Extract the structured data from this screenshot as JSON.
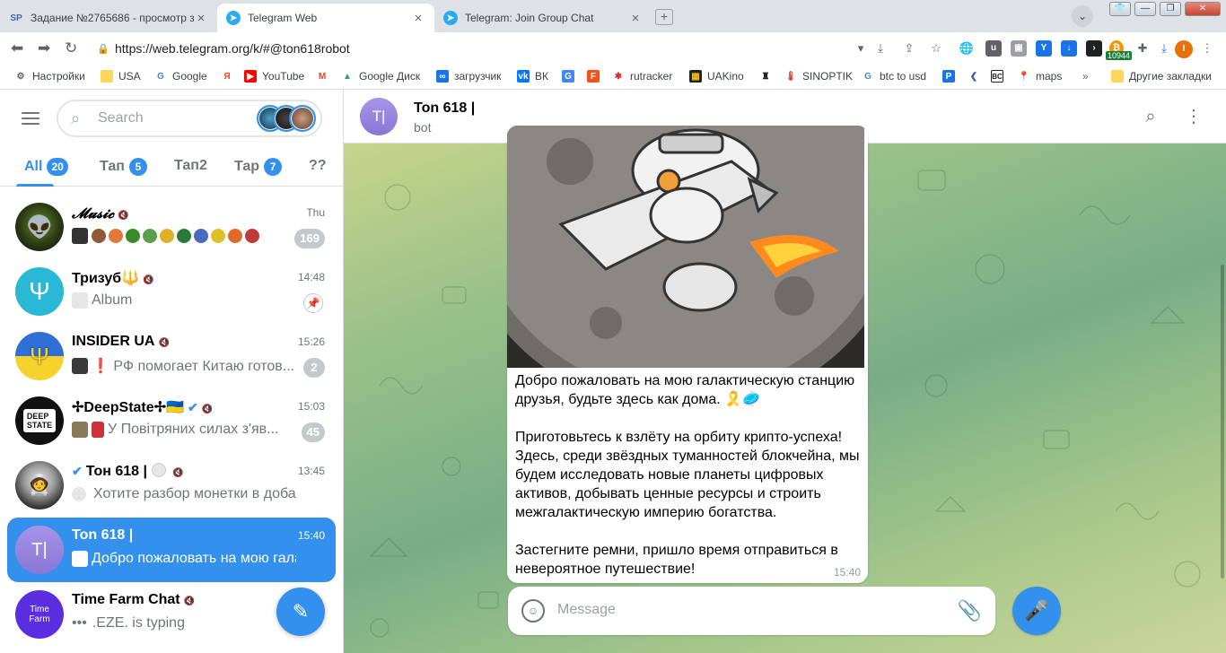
{
  "browser": {
    "tabs": [
      {
        "title": "Задание №2765686 - просмотр з",
        "favicon": "SP"
      },
      {
        "title": "Telegram Web",
        "favicon": "telegram-icon",
        "active": true
      },
      {
        "title": "Telegram: Join Group Chat",
        "favicon": "telegram-icon"
      }
    ],
    "url": "https://web.telegram.org/k/#@ton618robot",
    "extension_badge": "10944",
    "profile_initial": "I",
    "bookmarks": [
      {
        "label": "Настройки",
        "icon": "gear-icon"
      },
      {
        "label": "USA",
        "icon": "folder-icon"
      },
      {
        "label": "Google",
        "icon": "google-icon"
      },
      {
        "label": "",
        "icon": "yandex-icon"
      },
      {
        "label": "YouTube",
        "icon": "youtube-icon"
      },
      {
        "label": "",
        "icon": "gmail-icon"
      },
      {
        "label": "Google Диск",
        "icon": "drive-icon"
      },
      {
        "label": "загрузчик",
        "icon": "infinity-icon"
      },
      {
        "label": "ВК",
        "icon": "vk-icon"
      },
      {
        "label": "",
        "icon": "translate-icon"
      },
      {
        "label": "",
        "icon": "f-icon"
      },
      {
        "label": "rutracker",
        "icon": "rutracker-icon"
      },
      {
        "label": "UAKino",
        "icon": "film-icon"
      },
      {
        "label": "",
        "icon": "figure-icon"
      },
      {
        "label": "SINOPTIK",
        "icon": "thermometer-icon"
      },
      {
        "label": "btc to usd",
        "icon": "google-icon"
      },
      {
        "label": "",
        "icon": "p-icon"
      },
      {
        "label": "",
        "icon": "arrow-icon"
      },
      {
        "label": "",
        "icon": "bc-icon"
      },
      {
        "label": "maps",
        "icon": "maps-icon"
      }
    ],
    "bookmarks_overflow": "»",
    "other_bookmarks": "Другие закладки"
  },
  "sidebar": {
    "search_placeholder": "Search",
    "folders": [
      {
        "label": "All",
        "count": "20",
        "active": true
      },
      {
        "label": "Тап",
        "count": "5"
      },
      {
        "label": "Тап2",
        "count": ""
      },
      {
        "label": "Тар",
        "count": "7"
      },
      {
        "label": "??",
        "count": ""
      }
    ],
    "chats": [
      {
        "name": "𝓜𝓾𝓼𝓲𝓬",
        "time": "Thu",
        "preview": "",
        "badge": "169",
        "muted": true
      },
      {
        "name": "Тризуб🔱",
        "time": "14:48",
        "preview": "Album",
        "badge": "",
        "muted": true,
        "pinned": true
      },
      {
        "name": "INSIDER UA",
        "time": "15:26",
        "preview": "❗ РФ помогает Китаю готов...",
        "badge": "2",
        "muted": true
      },
      {
        "name": "✢DeepState✢🇺🇦",
        "time": "15:03",
        "preview": "У Повітряних силах з'яв...",
        "badge": "45",
        "muted": true,
        "verified": true
      },
      {
        "name": "Тон 618 |",
        "time": "13:45",
        "preview": "Хотите разбор монетки в добав...",
        "badge": "",
        "muted": true,
        "verified": true
      },
      {
        "name": "Ton 618 |",
        "time": "15:40",
        "preview": "Добро пожаловать на мою гала...",
        "badge": "",
        "selected": true
      },
      {
        "name": "Time Farm Chat",
        "time": "",
        "preview": ".EZE. is typing",
        "badge": "",
        "muted": true
      }
    ]
  },
  "chat": {
    "title": "Ton 618 |",
    "subtitle": "bot",
    "avatar_initials": "T|",
    "message": {
      "paragraphs": [
        "Добро пожаловать на мою галактическую станцию друзья, будьте здесь как дома. 🎗️🥏",
        "Приготовьтесь к взлёту на орбиту крипто-успеха! Здесь, среди звёздных туманностей блокчейна, мы будем исследовать новые планеты цифровых активов, добывать ценные ресурсы и строить межгалактическую империю богатства.",
        "Застегните ремни, пришло время отправиться в невероятное путешествие!"
      ],
      "time": "15:40"
    },
    "composer_placeholder": "Message"
  },
  "colors": {
    "accent": "#3390ec",
    "selected_chat": "#3390ec",
    "badge_muted": "#c4c9cc"
  }
}
